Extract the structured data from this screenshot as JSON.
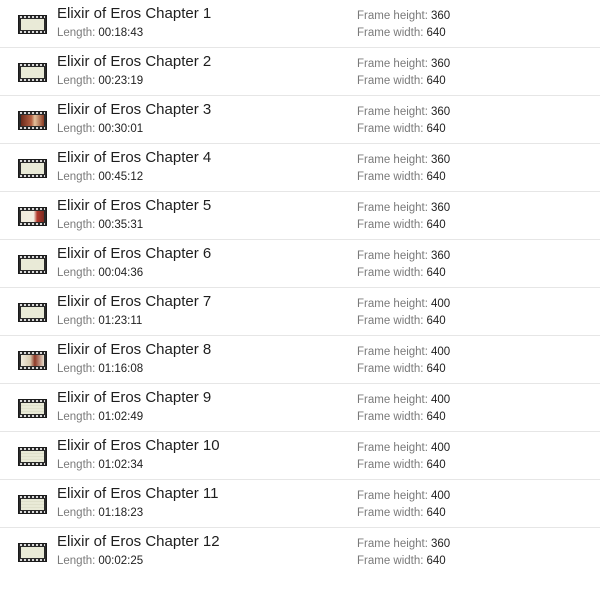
{
  "labels": {
    "length": "Length:",
    "frame_height": "Frame height:",
    "frame_width": "Frame width:"
  },
  "files": [
    {
      "name": "Elixir of Eros Chapter 1",
      "length": "00:18:43",
      "frame_height": "360",
      "frame_width": "640",
      "thumb": "blank"
    },
    {
      "name": "Elixir of Eros Chapter 2",
      "length": "00:23:19",
      "frame_height": "360",
      "frame_width": "640",
      "thumb": "blank"
    },
    {
      "name": "Elixir of Eros Chapter 3",
      "length": "00:30:01",
      "frame_height": "360",
      "frame_width": "640",
      "thumb": "photo"
    },
    {
      "name": "Elixir of Eros Chapter 4",
      "length": "00:45:12",
      "frame_height": "360",
      "frame_width": "640",
      "thumb": "blank"
    },
    {
      "name": "Elixir of Eros Chapter 5",
      "length": "00:35:31",
      "frame_height": "360",
      "frame_width": "640",
      "thumb": "photo-light"
    },
    {
      "name": "Elixir of Eros Chapter 6",
      "length": "00:04:36",
      "frame_height": "360",
      "frame_width": "640",
      "thumb": "blank"
    },
    {
      "name": "Elixir of Eros Chapter 7",
      "length": "01:23:11",
      "frame_height": "400",
      "frame_width": "640",
      "thumb": "blank"
    },
    {
      "name": "Elixir of Eros Chapter 8",
      "length": "01:16:08",
      "frame_height": "400",
      "frame_width": "640",
      "thumb": "photo-mixed"
    },
    {
      "name": "Elixir of Eros Chapter 9",
      "length": "01:02:49",
      "frame_height": "400",
      "frame_width": "640",
      "thumb": "lines"
    },
    {
      "name": "Elixir of Eros Chapter 10",
      "length": "01:02:34",
      "frame_height": "400",
      "frame_width": "640",
      "thumb": "lines"
    },
    {
      "name": "Elixir of Eros Chapter 11",
      "length": "01:18:23",
      "frame_height": "400",
      "frame_width": "640",
      "thumb": "lines"
    },
    {
      "name": "Elixir of Eros Chapter 12",
      "length": "00:02:25",
      "frame_height": "360",
      "frame_width": "640",
      "thumb": "blank"
    }
  ]
}
